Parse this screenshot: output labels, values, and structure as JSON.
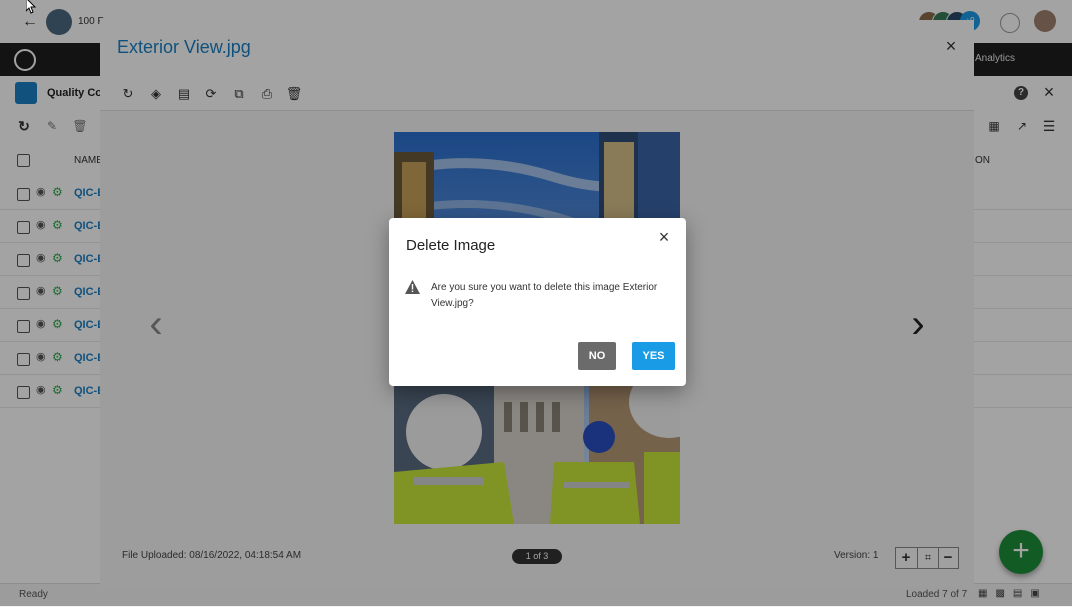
{
  "topbar": {
    "project_name": "100 F"
  },
  "navbar": {
    "analytics_label": "Analytics"
  },
  "module": {
    "title": "Quality Co"
  },
  "table": {
    "name_header": "NAME",
    "right_header": "ON",
    "rows": [
      {
        "label": "QIC-B"
      },
      {
        "label": "QIC-B"
      },
      {
        "label": "QIC-B"
      },
      {
        "label": "QIC-B"
      },
      {
        "label": "QIC-B"
      },
      {
        "label": "QIC-B"
      },
      {
        "label": "QIC-B"
      }
    ]
  },
  "status": {
    "ready": "Ready",
    "loaded": "Loaded 7 of 7"
  },
  "viewer": {
    "title": "Exterior View.jpg",
    "uploaded": "File Uploaded: 08/16/2022, 04:18:54 AM",
    "pager": "1 of 3",
    "version": "Version: 1"
  },
  "dialog": {
    "title": "Delete Image",
    "message": "Are you sure you want to delete this image Exterior View.jpg?",
    "no_label": "NO",
    "yes_label": "YES"
  },
  "avatars": {
    "more_count": "+9"
  },
  "colors": {
    "accent": "#1a9be6",
    "title_blue": "#1a7fc4",
    "fab_green": "#1e8f3a",
    "no_gray": "#6b6b6b"
  }
}
